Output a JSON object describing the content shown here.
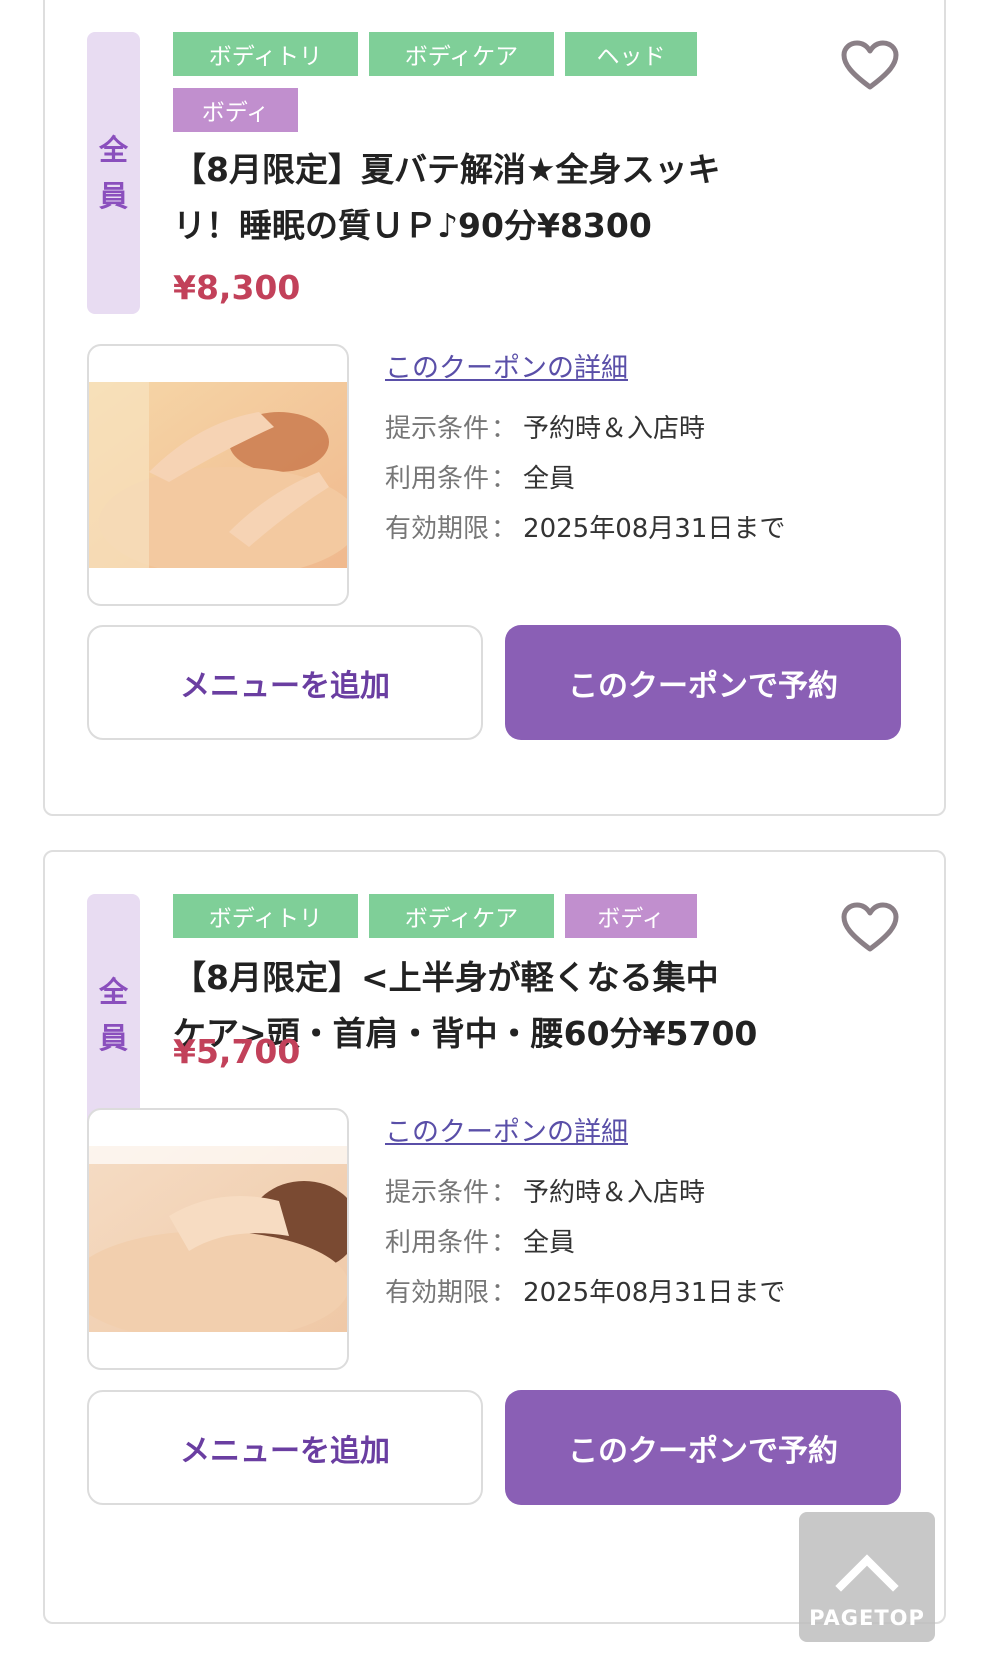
{
  "coupons": [
    {
      "target_label": [
        "全",
        "員"
      ],
      "tags": [
        {
          "label": "ボディトリ",
          "color": "#7fcf98"
        },
        {
          "label": "ボディケア",
          "color": "#7fcf98"
        },
        {
          "label": "ヘッド",
          "color": "#7fcf98"
        },
        {
          "label": "ボディ",
          "color": "#c18fce"
        }
      ],
      "title_line1": "【8月限定】夏バテ解消★全身スッキ",
      "title_line2": "リ！睡眠の質ＵＰ♪90分¥8300",
      "price": "¥8,300",
      "photo_icon": "massage-photo",
      "detail_link": "このクーポンの詳細",
      "conditions": [
        {
          "key": "提示条件",
          "value": "予約時＆入店時"
        },
        {
          "key": "利用条件",
          "value": "全員"
        },
        {
          "key": "有効期限",
          "value": "2025年08月31日まで"
        }
      ],
      "add_menu_label": "メニューを追加",
      "reserve_label": "このクーポンで予約"
    },
    {
      "target_label": [
        "全",
        "員"
      ],
      "tags": [
        {
          "label": "ボディトリ",
          "color": "#7fcf98"
        },
        {
          "label": "ボディケア",
          "color": "#7fcf98"
        },
        {
          "label": "ボディ",
          "color": "#c18fce"
        }
      ],
      "title_line1": "【8月限定】<上半身が軽くなる集中",
      "title_line2": "ケア>頭・首肩・背中・腰60分¥5700",
      "price": "¥5,700",
      "photo_icon": "massage-photo",
      "detail_link": "このクーポンの詳細",
      "conditions": [
        {
          "key": "提示条件",
          "value": "予約時＆入店時"
        },
        {
          "key": "利用条件",
          "value": "全員"
        },
        {
          "key": "有効期限",
          "value": "2025年08月31日まで"
        }
      ],
      "add_menu_label": "メニューを追加",
      "reserve_label": "このクーポンで予約"
    }
  ],
  "pagetop_label": "PAGETOP",
  "colors": {
    "accent": "#8a5fb5",
    "price": "#c2415a",
    "tag_green": "#7fcf98",
    "tag_purple": "#c18fce",
    "target_bg": "#e8dcf2"
  }
}
